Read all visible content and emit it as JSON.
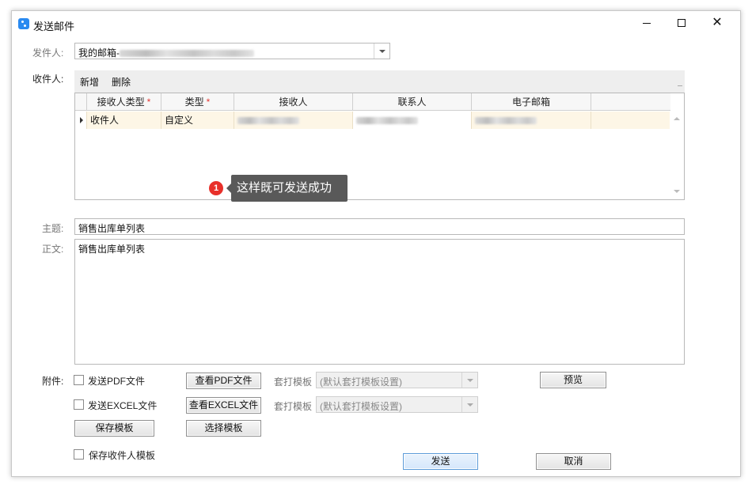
{
  "window": {
    "title": "发送邮件",
    "controls": {
      "minimize": "—",
      "close": "✕"
    }
  },
  "sender": {
    "label": "发件人:",
    "value": "我的邮箱-"
  },
  "recipients": {
    "label": "收件人:",
    "toolbar": {
      "add": "新增",
      "delete": "删除"
    },
    "columns": [
      {
        "label": "接收人类型",
        "required": true
      },
      {
        "label": "类型",
        "required": true
      },
      {
        "label": "接收人",
        "required": false
      },
      {
        "label": "联系人",
        "required": false
      },
      {
        "label": "电子邮箱",
        "required": false
      }
    ],
    "required_mark": "*",
    "rows": [
      {
        "recipient_type": "收件人",
        "type": "自定义"
      }
    ]
  },
  "tooltip": {
    "badge": "1",
    "text": "这样既可发送成功"
  },
  "subject": {
    "label": "主题:",
    "value": "销售出库单列表"
  },
  "body": {
    "label": "正文:",
    "value": "销售出库单列表"
  },
  "attachments": {
    "label": "附件:",
    "pdf_checkbox": "发送PDF文件",
    "view_pdf": "查看PDF文件",
    "excel_checkbox": "发送EXCEL文件",
    "view_excel": "查看EXCEL文件",
    "template_label": "套打模板",
    "template_value": "(默认套打模板设置)",
    "preview": "预览",
    "save_template": "保存模板",
    "select_template": "选择模板"
  },
  "footer": {
    "save_recipient_template": "保存收件人模板",
    "send": "发送",
    "cancel": "取消"
  }
}
